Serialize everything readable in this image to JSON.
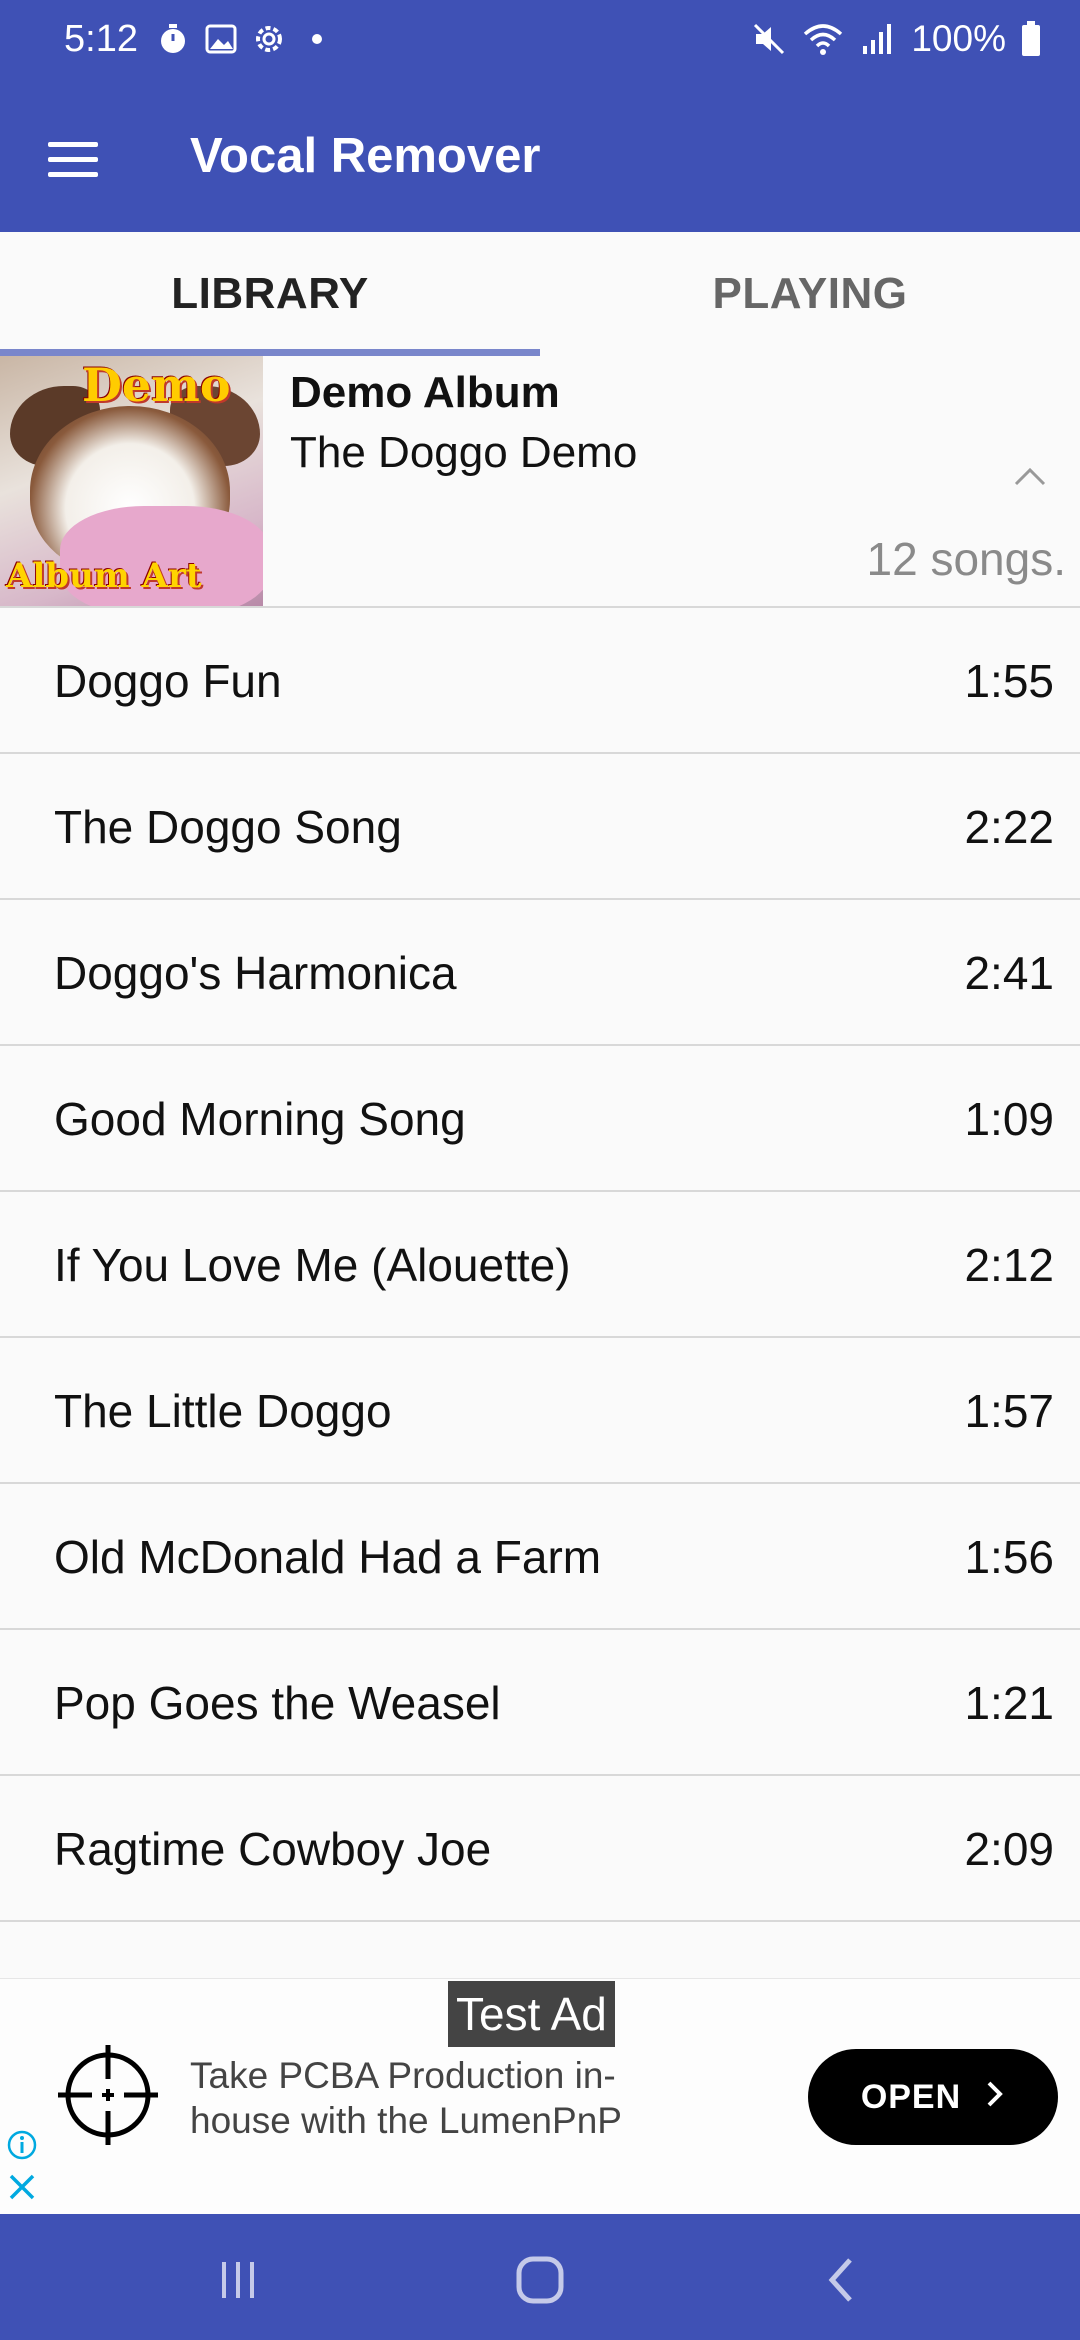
{
  "status_bar": {
    "time": "5:12",
    "battery": "100%",
    "left_icons": [
      "timer-icon",
      "image-icon",
      "settings-icon",
      "dot-icon"
    ],
    "right_icons": [
      "mute-icon",
      "wifi-icon",
      "signal-icon",
      "battery-icon"
    ]
  },
  "app_bar": {
    "title": "Vocal Remover",
    "menu_icon": "hamburger-menu-icon"
  },
  "tabs": [
    {
      "label": "LIBRARY",
      "active": true
    },
    {
      "label": "PLAYING",
      "active": false
    }
  ],
  "album": {
    "name": "Demo Album",
    "artist": "The Doggo Demo",
    "song_count": "12 songs.",
    "art_text_top": "Demo",
    "art_text_bottom": "Album Art"
  },
  "songs": [
    {
      "title": "Doggo Fun",
      "duration": "1:55"
    },
    {
      "title": "The Doggo Song",
      "duration": "2:22"
    },
    {
      "title": "Doggo's Harmonica",
      "duration": "2:41"
    },
    {
      "title": "Good Morning Song",
      "duration": "1:09"
    },
    {
      "title": "If You Love Me (Alouette)",
      "duration": "2:12"
    },
    {
      "title": "The Little Doggo",
      "duration": "1:57"
    },
    {
      "title": "Old McDonald Had a Farm",
      "duration": "1:56"
    },
    {
      "title": "Pop Goes the Weasel",
      "duration": "1:21"
    },
    {
      "title": "Ragtime Cowboy Joe",
      "duration": "2:09"
    }
  ],
  "ad": {
    "label": "Test Ad",
    "text": "Take PCBA Production in-house with the LumenPnP",
    "button": "OPEN"
  },
  "colors": {
    "primary": "#3f51b5",
    "tab_indicator": "#7986cb",
    "background": "#fafafa"
  }
}
